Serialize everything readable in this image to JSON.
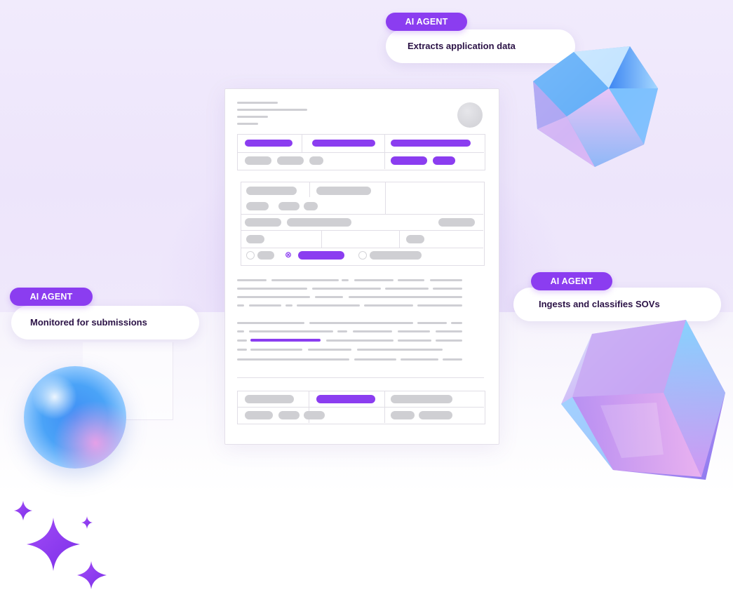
{
  "agents": [
    {
      "badge": "AI AGENT",
      "label": "Extracts application data"
    },
    {
      "badge": "AI AGENT",
      "label": "Monitored for submissions"
    },
    {
      "badge": "AI AGENT",
      "label": "Ingests and classifies SOVs"
    }
  ],
  "colors": {
    "accent": "#8b3df0",
    "background_top": "#efe8fb",
    "card_text": "#2b1246",
    "placeholder": "#cfcfd3"
  },
  "icons": [
    "crystal-gem-icon",
    "glass-cube-icon",
    "glass-sphere-icon",
    "sparkle-icon"
  ]
}
